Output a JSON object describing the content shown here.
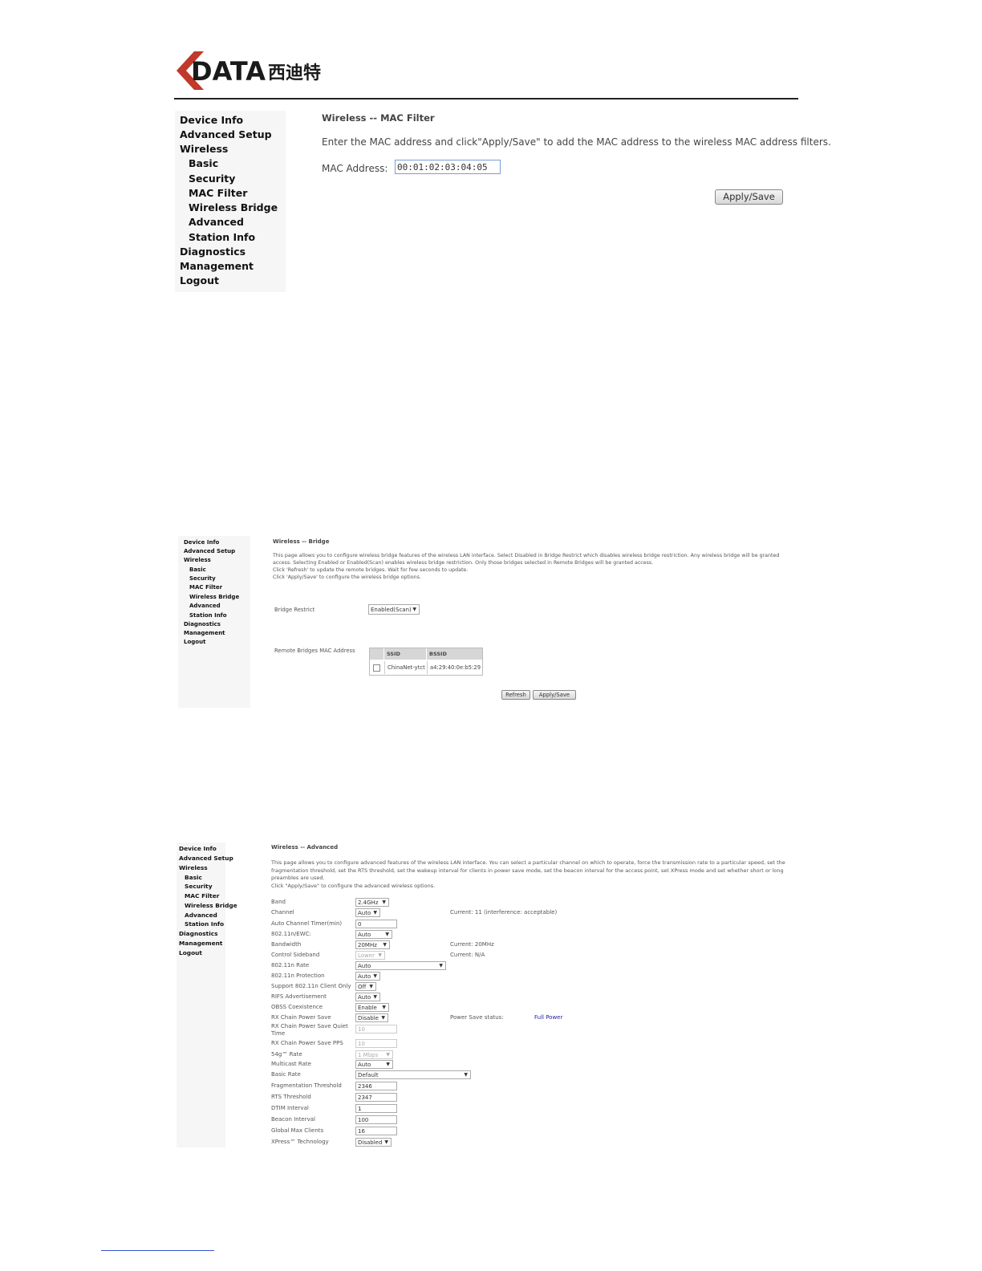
{
  "brand": {
    "logo_text": "DATA",
    "logo_cn": "西迪特",
    "accent": "#c0392b"
  },
  "sidebar": {
    "items": [
      {
        "label": "Device Info",
        "level": 0
      },
      {
        "label": "Advanced Setup",
        "level": 0
      },
      {
        "label": "Wireless",
        "level": 0
      },
      {
        "label": "Basic",
        "level": 1
      },
      {
        "label": "Security",
        "level": 1
      },
      {
        "label": "MAC Filter",
        "level": 1
      },
      {
        "label": "Wireless Bridge",
        "level": 1
      },
      {
        "label": "Advanced",
        "level": 1
      },
      {
        "label": "Station Info",
        "level": 1
      },
      {
        "label": "Diagnostics",
        "level": 0
      },
      {
        "label": "Management",
        "level": 0
      },
      {
        "label": "Logout",
        "level": 0
      }
    ]
  },
  "mac_filter": {
    "title": "Wireless -- MAC Filter",
    "description": "Enter the MAC address and click\"Apply/Save\" to add the MAC address to the wireless MAC address filters.",
    "mac_label": "MAC Address:",
    "mac_value": "00:01:02:03:04:05",
    "apply_label": "Apply/Save"
  },
  "bridge": {
    "title": "Wireless -- Bridge",
    "desc1": "This page allows you to configure wireless bridge features of the wireless LAN interface. Select Disabled in Bridge Restrict which disables wireless bridge restriction. Any wireless bridge will be granted",
    "desc2": "access. Selecting Enabled or Enabled(Scan) enables wireless bridge restriction. Only those bridges selected in Remote Bridges will be granted access.",
    "desc3": "Click 'Refresh' to update the remote bridges. Wait for few seconds to update.",
    "desc4": "Click 'Apply/Save' to configure the wireless bridge options.",
    "restrict_label": "Bridge Restrict",
    "restrict_value": "Enabled(Scan)",
    "remote_label": "Remote Bridges MAC Address",
    "table_headers": [
      "SSID",
      "BSSID"
    ],
    "table_rows": [
      {
        "ssid": "ChinaNet-ytct",
        "bssid": "a4:29:40:0e:b5:29"
      }
    ],
    "refresh_label": "Refresh",
    "apply_label": "Apply/Save"
  },
  "advanced": {
    "title": "Wireless -- Advanced",
    "desc1": "This page allows you to configure advanced features of the wireless LAN interface. You can select a particular channel on which to operate, force the transmission rate to a particular speed, set the",
    "desc2": "fragmentation threshold, set the RTS threshold, set the wakeup interval for clients in power save mode, set the beacon interval for the access point, set XPress mode and set whether short or long",
    "desc3": "preambles are used.",
    "desc4": "Click \"Apply/Save\" to configure the advanced wireless options.",
    "rows": [
      {
        "label": "Band",
        "value": "2.4GHz"
      },
      {
        "label": "Channel",
        "value": "Auto"
      },
      {
        "label": "Auto Channel Timer(min)",
        "value": "0"
      },
      {
        "label": "802.11n/EWC:",
        "value": "Auto"
      },
      {
        "label": "Bandwidth",
        "value": "20MHz"
      },
      {
        "label": "Control Sideband",
        "value": "Lower"
      },
      {
        "label": "802.11n Rate",
        "value": "Auto"
      },
      {
        "label": "802.11n Protection",
        "value": "Auto"
      },
      {
        "label": "Support 802.11n Client Only",
        "value": "Off"
      },
      {
        "label": "RIFS Advertisement",
        "value": "Auto"
      },
      {
        "label": "OBSS Coexistence",
        "value": "Enable"
      },
      {
        "label": "RX Chain Power Save",
        "value": "Disable"
      },
      {
        "label": "RX Chain Power Save Quiet Time",
        "value": "10"
      },
      {
        "label": "RX Chain Power Save PPS",
        "value": "10"
      },
      {
        "label": "54g™ Rate",
        "value": "1 Mbps"
      },
      {
        "label": "Multicast Rate",
        "value": "Auto"
      },
      {
        "label": "Basic Rate",
        "value": "Default"
      },
      {
        "label": "Fragmentation Threshold",
        "value": "2346"
      },
      {
        "label": "RTS Threshold",
        "value": "2347"
      },
      {
        "label": "DTIM Interval",
        "value": "1"
      },
      {
        "label": "Beacon Interval",
        "value": "100"
      },
      {
        "label": "Global Max Clients",
        "value": "16"
      },
      {
        "label": "XPress™ Technology",
        "value": "Disabled"
      }
    ],
    "channel_current": "Current: 11 (interference: acceptable)",
    "bandwidth_current": "Current: 20MHz",
    "sideband_current": "Current: N/A",
    "power_save_label": "Power Save status:",
    "power_save_value": "Full Power",
    "link_color": "#2222aa"
  }
}
